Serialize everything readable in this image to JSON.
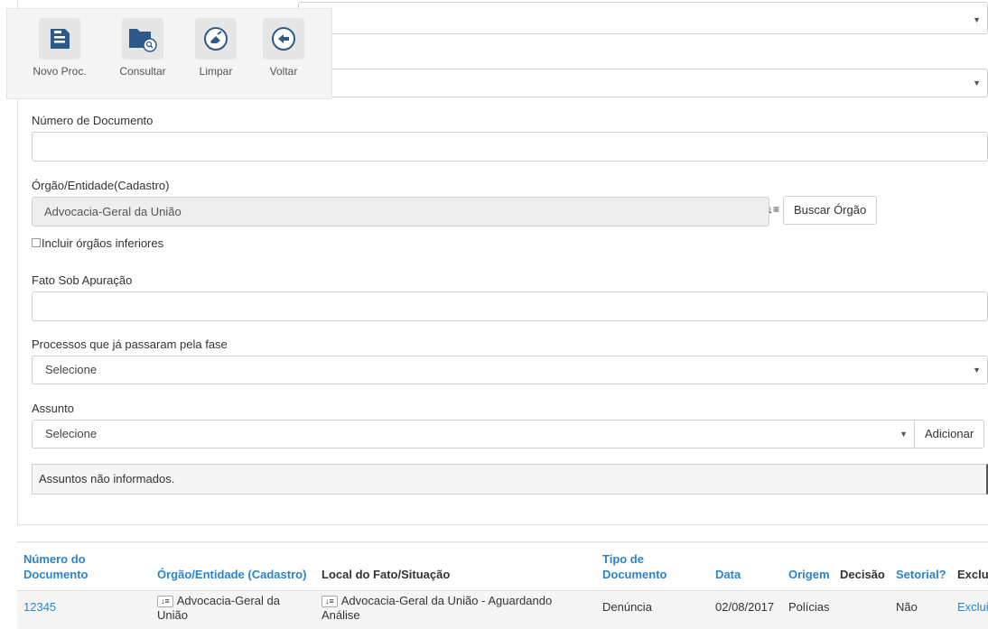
{
  "toolbar": {
    "items": [
      {
        "label": "Novo Proc.",
        "icon": "save-icon"
      },
      {
        "label": "Consultar",
        "icon": "folder-search-icon"
      },
      {
        "label": "Limpar",
        "icon": "eraser-icon"
      },
      {
        "label": "Voltar",
        "icon": "back-arrow-icon"
      }
    ]
  },
  "form": {
    "numero_documento_label": "Número de Documento",
    "orgao_label": "Órgão/Entidade(Cadastro)",
    "orgao_value": "Advocacia-Geral da União",
    "buscar_orgao_label": "Buscar Órgão",
    "incluir_inferiores_label": "Incluir órgãos inferiores",
    "fato_label": "Fato Sob Apuração",
    "fase_label": "Processos que já passaram pela fase",
    "fase_value": "Selecione",
    "assunto_label": "Assunto",
    "assunto_value": "Selecione",
    "adicionar_label": "Adicionar",
    "assuntos_msg": "Assuntos não informados."
  },
  "table": {
    "headers": {
      "numero": "Número do Documento",
      "orgao": "Órgão/Entidade (Cadastro)",
      "local": "Local do Fato/Situação",
      "tipo": "Tipo de Documento",
      "data": "Data",
      "origem": "Origem",
      "decisao": "Decisão",
      "setorial": "Setorial?",
      "excluir": "Exclu"
    },
    "rows": [
      {
        "numero": "12345",
        "orgao": "Advocacia-Geral da União",
        "local": "Advocacia-Geral da União - Aguardando Análise",
        "tipo": "Denúncia",
        "data": "02/08/2017",
        "origem": "Polícias",
        "decisao": "",
        "setorial": "Não",
        "excluir": "Exclui"
      }
    ]
  },
  "colors": {
    "accent": "#2a85c9",
    "icon": "#2e5a8a"
  }
}
